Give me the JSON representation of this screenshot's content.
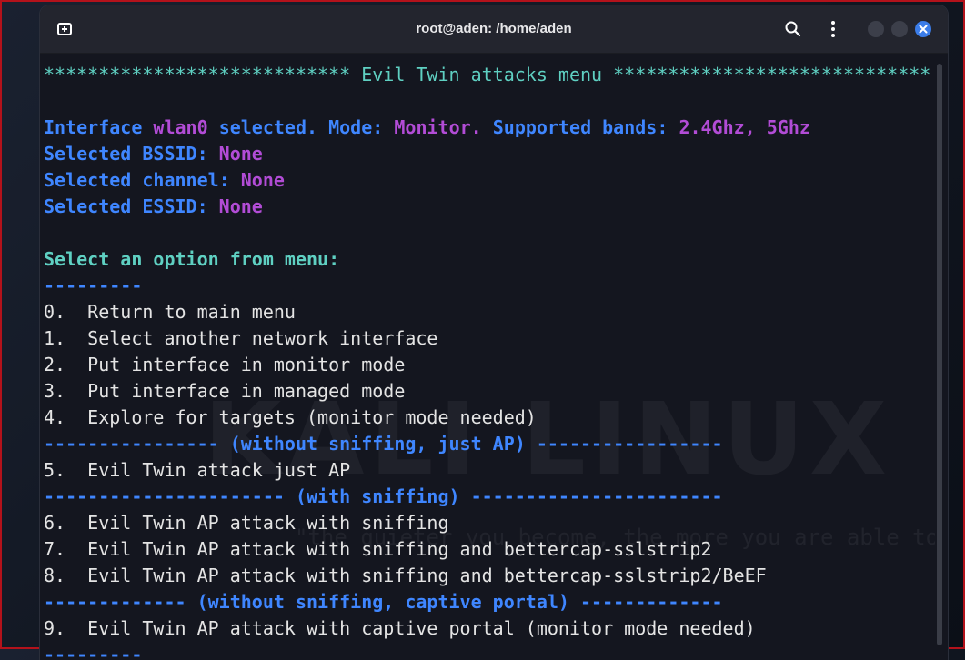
{
  "window": {
    "title": "root@aden: /home/aden",
    "icons": {
      "new_tab": "new-tab-icon",
      "search": "search-icon",
      "menu": "kebab-menu-icon",
      "close": "close-icon"
    },
    "accent": "#3b7de9"
  },
  "terminal": {
    "header": "**************************** Evil Twin attacks menu *****************************",
    "iface_label": "Interface",
    "iface_value": "wlan0",
    "iface_mid": "selected. Mode:",
    "mode_value": "Monitor.",
    "bands_label": "Supported bands:",
    "bands_value": "2.4Ghz, 5Ghz",
    "bssid_label": "Selected BSSID:",
    "bssid_value": "None",
    "channel_label": "Selected channel:",
    "channel_value": "None",
    "essid_label": "Selected ESSID:",
    "essid_value": "None",
    "prompt": "Select an option from menu:",
    "dashes": "---------",
    "options": [
      "0.  Return to main menu",
      "1.  Select another network interface",
      "2.  Put interface in monitor mode",
      "3.  Put interface in managed mode",
      "4.  Explore for targets (monitor mode needed)"
    ],
    "sep_just_ap": "---------------- (without sniffing, just AP) -----------------",
    "option5": "5.  Evil Twin attack just AP",
    "sep_sniffing": "---------------------- (with sniffing) -----------------------",
    "options_sniff": [
      "6.  Evil Twin AP attack with sniffing",
      "7.  Evil Twin AP attack with sniffing and bettercap-sslstrip2",
      "8.  Evil Twin AP attack with sniffing and bettercap-sslstrip2/BeEF"
    ],
    "sep_portal": "------------- (without sniffing, captive portal) -------------",
    "option9": "9.  Evil Twin AP attack with captive portal (monitor mode needed)",
    "bottom_dashes": "---------"
  },
  "background": {
    "watermark": "KALI LINUX",
    "watermark_sub": "\"the quieter you become, the more you are able to hear\""
  }
}
